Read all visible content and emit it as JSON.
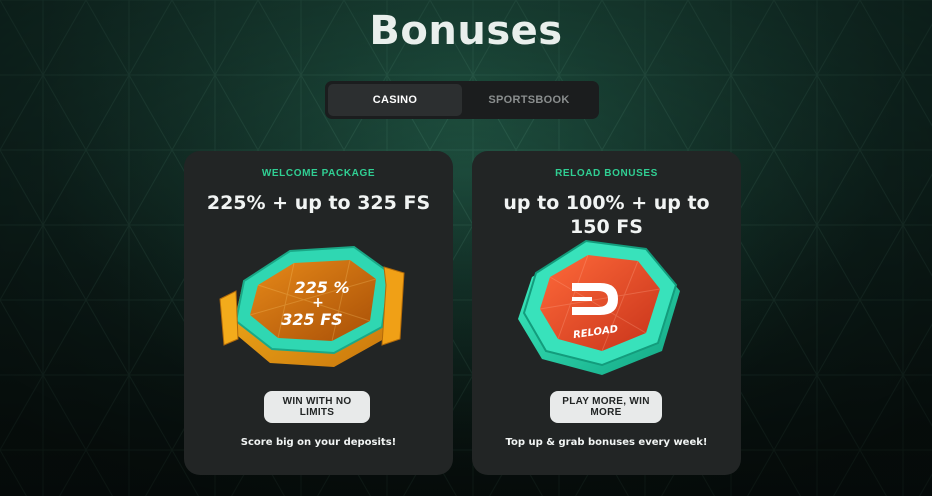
{
  "page": {
    "title": "Bonuses"
  },
  "tabs": [
    {
      "label": "CASINO",
      "active": true
    },
    {
      "label": "SPORTSBOOK",
      "active": false
    }
  ],
  "cards": [
    {
      "eyebrow": "WELCOME PACKAGE",
      "headline": "225% + up to 325 FS",
      "art_text_line1": "225 %",
      "art_text_line2": "+",
      "art_text_line3": "325 FS",
      "button_label": "WIN WITH NO LIMITS",
      "caption": "Score big on your deposits!"
    },
    {
      "eyebrow": "RELOAD BONUSES",
      "headline": "up to 100% + up to 150 FS",
      "art_text": "RELOAD",
      "button_label": "PLAY MORE, WIN MORE",
      "caption": "Top up & grab bonuses every week!"
    }
  ],
  "colors": {
    "accent_green": "#30cf93",
    "card_bg": "#222525",
    "button_bg": "#e8eaea",
    "background": "#0f1d19"
  }
}
